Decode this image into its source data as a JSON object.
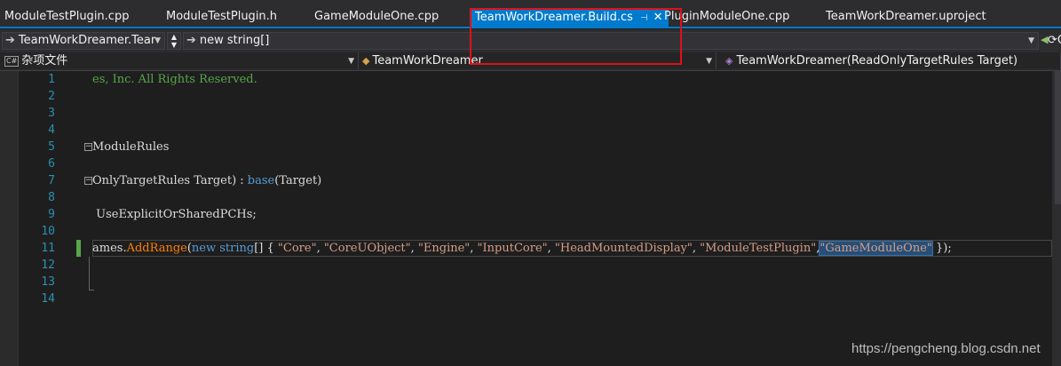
{
  "tabs": [
    {
      "label": "ModuleTestPlugin.cpp"
    },
    {
      "label": "ModuleTestPlugin.h"
    },
    {
      "label": "GameModuleOne.cpp"
    },
    {
      "label": "TeamWorkDreamer.Build.cs",
      "active": true
    },
    {
      "label": "PluginModuleOne.cpp"
    },
    {
      "label": "TeamWorkDreamer.uproject"
    }
  ],
  "toolbar": {
    "navigate_combo": "TeamWorkDreamer.Tear",
    "find_text": "new string[]"
  },
  "navbar": {
    "project_icon": "C#",
    "project": "杂项文件",
    "type": "TeamWorkDreamer",
    "member": "TeamWorkDreamer(ReadOnlyTargetRules Target)"
  },
  "editor": {
    "line_numbers": [
      "1",
      "2",
      "3",
      "4",
      "5",
      "6",
      "7",
      "8",
      "9",
      "10",
      "11",
      "12",
      "13",
      "14"
    ],
    "lines": {
      "l1": "es, Inc. All Rights Reserved.",
      "l5": "ModuleRules",
      "l7_a": "OnlyTargetRules Target) : ",
      "l7_base": "base",
      "l7_b": "(Target)",
      "l9": " UseExplicitOrSharedPCHs;",
      "l11": {
        "a": "ames.",
        "method": "AddRange",
        "b": "(",
        "kw_new": "new",
        "sp": " ",
        "kw_string": "string",
        "c": "[] { ",
        "s1": "\"Core\"",
        "s2": "\"CoreUObject\"",
        "s3": "\"Engine\"",
        "s4": "\"InputCore\"",
        "s5": "\"HeadMountedDisplay\"",
        "s6": "\"ModuleTestPlugin\"",
        "s7": "\"GameModuleOne\"",
        "comma": ", ",
        "comma_tight": ",",
        "end": " });"
      }
    }
  },
  "colors": {
    "accent": "#007acc",
    "highlight_box": "#e0101a",
    "comment": "#57a64a",
    "keyword": "#569cd6",
    "string": "#d69d85",
    "method": "#ff8000",
    "line_number": "#2b91af"
  },
  "watermark": "https://pengcheng.blog.csdn.net"
}
